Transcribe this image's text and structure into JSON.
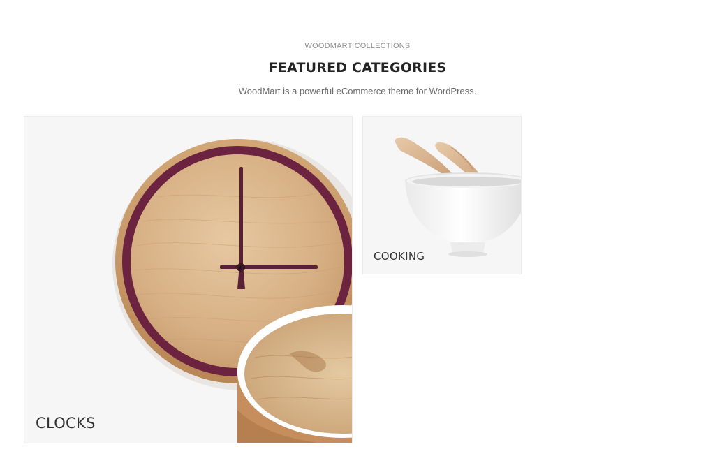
{
  "section": {
    "eyebrow": "WOODMART COLLECTIONS",
    "title": "FEATURED CATEGORIES",
    "subtitle": "WoodMart is a powerful eCommerce theme for WordPress."
  },
  "categories": [
    {
      "label": "CLOCKS",
      "image_icon": "wooden-clock-image"
    },
    {
      "label": "COOKING",
      "image_icon": "bowl-with-spoons-image"
    }
  ],
  "colors": {
    "heading": "#242424",
    "muted": "#8f8f8f",
    "text": "#6b6b6b",
    "card_bg": "#f6f6f6",
    "wood": "#d8b48a",
    "clock_ring": "#6b2340"
  }
}
